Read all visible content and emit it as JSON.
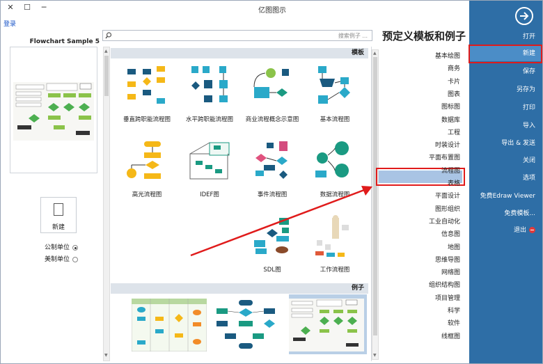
{
  "window": {
    "title": "亿图图示",
    "minimize": "─",
    "maximize": "☐",
    "close": "✕"
  },
  "login": "登录",
  "heading": "预定义模板和例子",
  "search": {
    "placeholder": "搜索例子 ..."
  },
  "sidebar": {
    "back_icon": "arrow-right-circle-icon",
    "items": [
      {
        "label": "打开"
      },
      {
        "label": "新建"
      },
      {
        "label": "保存"
      },
      {
        "label": "另存为"
      },
      {
        "label": "打印"
      },
      {
        "label": "导入"
      },
      {
        "label": "导出 & 发送"
      },
      {
        "label": "关闭"
      },
      {
        "label": "选项"
      },
      {
        "label": "免费Edraw Viewer"
      },
      {
        "label": "免费模板..."
      },
      {
        "label": "退出"
      }
    ],
    "accent_color": "#2e6ea6"
  },
  "categories": [
    "基本绘图",
    "商务",
    "卡片",
    "图表",
    "图标图",
    "数据库",
    "工程",
    "时装设计",
    "平面布置图",
    "流程图",
    "表格",
    "平面设计",
    "图形组织",
    "工业自动化",
    "信息图",
    "地图",
    "思维导图",
    "网络图",
    "组织结构图",
    "项目管理",
    "科学",
    "软件",
    "线框图"
  ],
  "selected_category": "流程图",
  "sections": {
    "templates": "模板",
    "examples": "例子"
  },
  "templates": [
    {
      "label": "基本流程图"
    },
    {
      "label": "商业流程概念示意图"
    },
    {
      "label": "水平跨职能流程图"
    },
    {
      "label": "垂直跨职能流程图"
    },
    {
      "label": "数据流程图"
    },
    {
      "label": "事件流程图"
    },
    {
      "label": "IDEF图"
    },
    {
      "label": "高光流程图"
    },
    {
      "label": "工作流程图"
    },
    {
      "label": "SDL图"
    }
  ],
  "preview": {
    "title": "Flowchart Sample 5"
  },
  "new_button": {
    "label": "新建"
  },
  "units": [
    {
      "label": "公制单位",
      "selected": true
    },
    {
      "label": "美制单位",
      "selected": false
    }
  ]
}
